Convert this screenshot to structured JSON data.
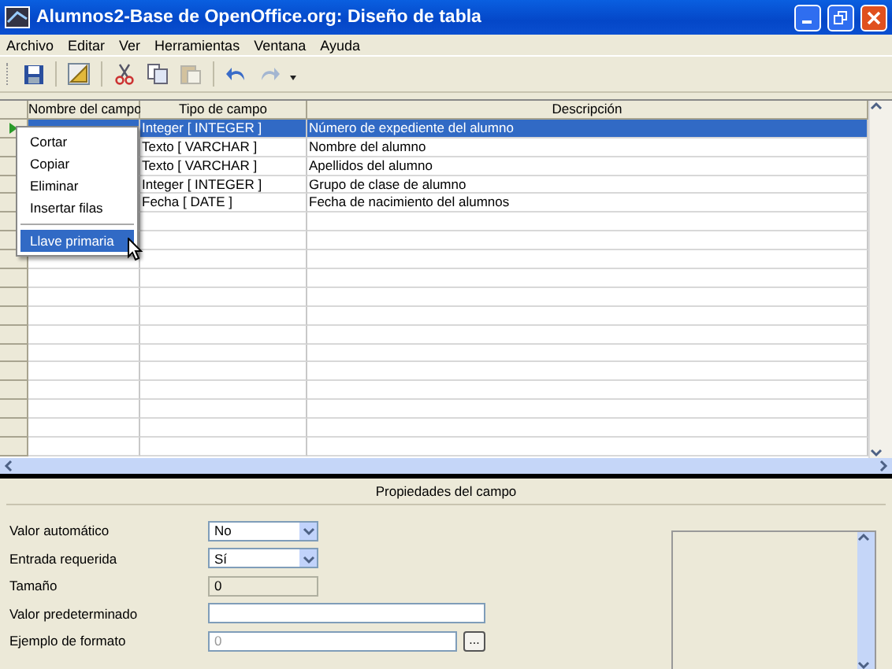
{
  "window": {
    "title": "Alumnos2-Base de OpenOffice.org: Diseño de tabla"
  },
  "menu": [
    "Archivo",
    "Editar",
    "Ver",
    "Herramientas",
    "Ventana",
    "Ayuda"
  ],
  "toolbar": [
    {
      "kind": "save",
      "disabled": false
    },
    {
      "kind": "design",
      "disabled": false
    },
    {
      "kind": "cut",
      "disabled": false
    },
    {
      "kind": "copy",
      "disabled": false
    },
    {
      "kind": "paste",
      "disabled": true
    },
    {
      "kind": "undo",
      "disabled": false
    },
    {
      "kind": "redo",
      "disabled": true
    }
  ],
  "table": {
    "columns": [
      "Nombre del campo",
      "Tipo de campo",
      "Descripción"
    ],
    "rows": [
      {
        "type": "Integer [ INTEGER ]",
        "description": "Número de expediente del alumno",
        "selected": true,
        "current": true
      },
      {
        "type": "Texto [ VARCHAR ]",
        "description": "Nombre del alumno",
        "selected": false,
        "current": false
      },
      {
        "type": "Texto [ VARCHAR ]",
        "description": "Apellidos del alumno",
        "selected": false,
        "current": false
      },
      {
        "type": "Integer [ INTEGER ]",
        "description": "Grupo de clase de alumno",
        "selected": false,
        "current": false
      },
      {
        "type": "Fecha [ DATE ]",
        "description": "Fecha de nacimiento del alumnos",
        "selected": false,
        "current": false
      }
    ]
  },
  "context_menu": {
    "groups": [
      [
        {
          "label": "Cortar",
          "selected": false
        },
        {
          "label": "Copiar",
          "selected": false
        },
        {
          "label": "Eliminar",
          "selected": false
        },
        {
          "label": "Insertar filas",
          "selected": false
        }
      ],
      [
        {
          "label": "Llave primaria",
          "selected": true
        }
      ]
    ]
  },
  "properties": {
    "title": "Propiedades del campo",
    "fields": [
      {
        "label": "Valor automático",
        "kind": "select",
        "value": "No"
      },
      {
        "label": "Entrada requerida",
        "kind": "select",
        "value": "Sí"
      },
      {
        "label": "Tamaño",
        "kind": "readonly",
        "value": "0"
      },
      {
        "label": "Valor predeterminado",
        "kind": "input"
      },
      {
        "label": "Ejemplo de formato",
        "kind": "format",
        "value": "0",
        "button": "..."
      }
    ]
  }
}
